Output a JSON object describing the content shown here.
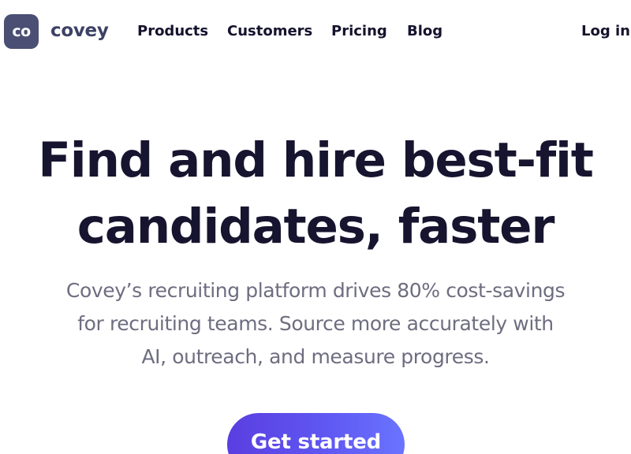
{
  "nav": {
    "logo_mark": "co",
    "logo_word": "covey",
    "links": [
      {
        "label": "Products"
      },
      {
        "label": "Customers"
      },
      {
        "label": "Pricing"
      },
      {
        "label": "Blog"
      }
    ],
    "login": "Log in"
  },
  "hero": {
    "title_lines": [
      "Find and hire best-fit",
      "candidates, faster"
    ],
    "subtitle_lines": [
      "Covey’s recruiting platform drives 80% cost-savings",
      "for recruiting teams. Source more accurately with",
      "AI, outreach, and measure progress."
    ],
    "cta_label": "Get started"
  },
  "colors": {
    "logo_bg": "#4a4f73",
    "heading": "#17142f",
    "subtitle": "#6e6d80",
    "cta_start": "#5a3ee0",
    "cta_end": "#6a74ff"
  }
}
